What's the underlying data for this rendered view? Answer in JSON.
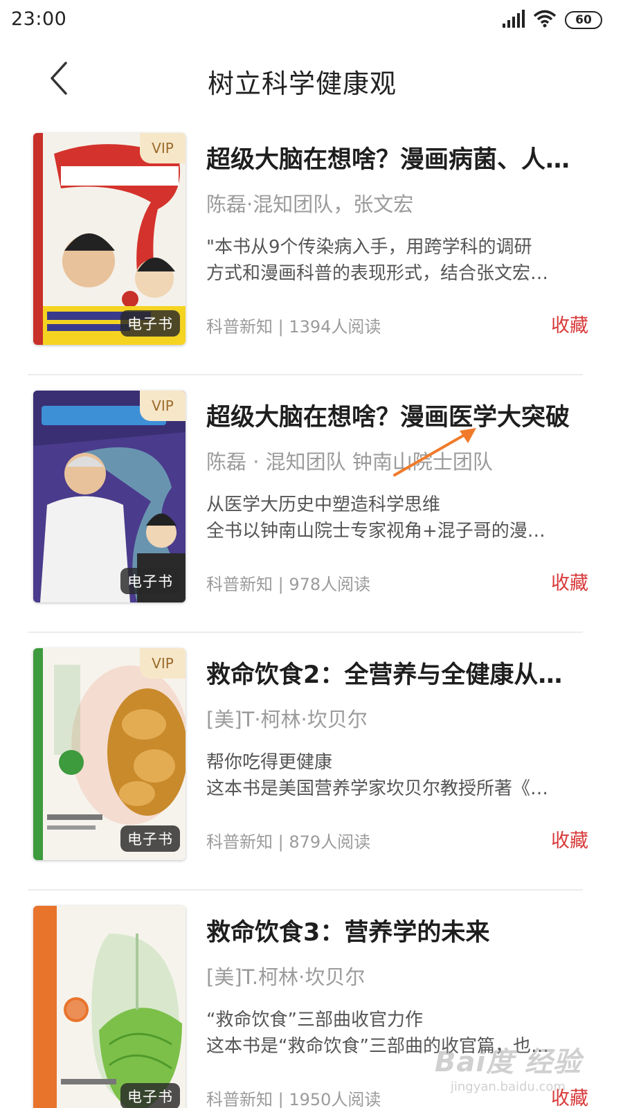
{
  "status_bar": {
    "time": "23:00",
    "battery": "60",
    "icons": [
      "signal-icon",
      "wifi-icon",
      "battery-icon"
    ]
  },
  "nav": {
    "title": "树立科学健康观",
    "back_icon": "chevron-left-icon"
  },
  "books": [
    {
      "title": "超级大脑在想啥？漫画病菌、人…",
      "author": "陈磊·混知团队，张文宏",
      "desc_line1": "\"本书从9个传染病入手，用跨学科的调研",
      "desc_line2": "方式和漫画科普的表现形式，结合张文宏…",
      "meta": "科普新知 | 1394人阅读",
      "fav": "收藏",
      "vip": "VIP",
      "tag": "电子书",
      "cover_bg": "#d4322c"
    },
    {
      "title": "超级大脑在想啥？漫画医学大突破",
      "author": "陈磊 · 混知团队 钟南山院士团队",
      "desc_line1": "从医学大历史中塑造科学思维",
      "desc_line2": "全书以钟南山院士专家视角+混子哥的漫…",
      "meta": "科普新知 | 978人阅读",
      "fav": "收藏",
      "vip": "VIP",
      "tag": "电子书",
      "cover_bg": "#4a3b8c"
    },
    {
      "title": "救命饮食2：全营养与全健康从…",
      "author": "[美]T·柯林·坎贝尔",
      "desc_line1": "帮你吃得更健康",
      "desc_line2": "这本书是美国营养学家坎贝尔教授所著《…",
      "meta": "科普新知 | 879人阅读",
      "fav": "收藏",
      "vip": "VIP",
      "tag": "电子书",
      "cover_bg": "#3d9a3d"
    },
    {
      "title": "救命饮食3：营养学的未来",
      "author": "[美]T.柯林·坎贝尔",
      "desc_line1": "“救命饮食”三部曲收官力作",
      "desc_line2": "这本书是“救命饮食”三部曲的收官篇，也…",
      "meta": "科普新知 | 1950人阅读",
      "fav": "收藏",
      "vip": "",
      "tag": "电子书",
      "cover_bg": "#e8742c"
    }
  ],
  "watermark": {
    "logo": "Bai度 经验",
    "url": "jingyan.baidu.com"
  },
  "colors": {
    "accent": "#d8393a",
    "vip_bg": "#f7e7c9",
    "vip_text": "#9a6a2a",
    "arrow": "#f07a2a"
  }
}
